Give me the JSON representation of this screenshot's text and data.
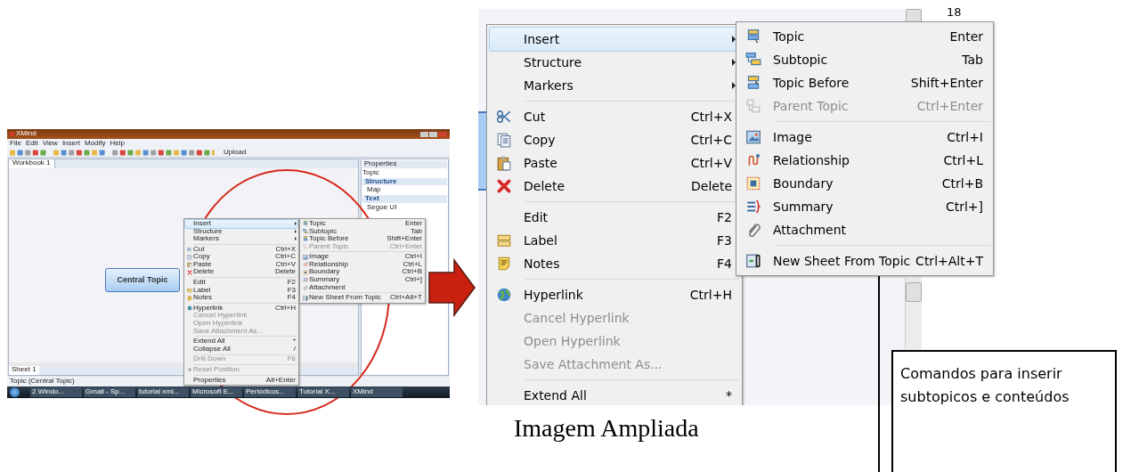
{
  "small_screenshot": {
    "window_title": "XMind",
    "menu": [
      "File",
      "Edit",
      "View",
      "Insert",
      "Modify",
      "Help"
    ],
    "upload": "Upload",
    "tab": "Workbook 1",
    "central_topic": "Central Topic",
    "properties": {
      "title": "Properties",
      "label": "Topic",
      "sections": [
        {
          "title": "Structure",
          "value": "Map"
        },
        {
          "title": "Text",
          "value": "Segoe UI"
        }
      ]
    },
    "sheet_tab": "Sheet 1",
    "status": "Topic (Central Topic)",
    "taskbar": [
      "2 Windo...",
      "Gmail - Sp...",
      "tutorial xml...",
      "Microsoft E...",
      "Periódicos...",
      "Tutorial X...",
      "XMind"
    ],
    "context_menu": [
      {
        "kind": "item",
        "label": "Insert",
        "submenu": true,
        "disabled": false,
        "selected": true
      },
      {
        "kind": "item",
        "label": "Structure",
        "submenu": true,
        "disabled": false,
        "selected": false
      },
      {
        "kind": "item",
        "label": "Markers",
        "submenu": true,
        "disabled": false,
        "selected": false
      },
      {
        "kind": "separator"
      },
      {
        "kind": "item",
        "label": "Cut",
        "shortcut": "Ctrl+X",
        "submenu": false,
        "disabled": false,
        "selected": false
      },
      {
        "kind": "item",
        "label": "Copy",
        "shortcut": "Ctrl+C",
        "submenu": false,
        "disabled": false,
        "selected": false
      },
      {
        "kind": "item",
        "label": "Paste",
        "shortcut": "Ctrl+V",
        "submenu": false,
        "disabled": false,
        "selected": false
      },
      {
        "kind": "item",
        "label": "Delete",
        "shortcut": "Delete",
        "submenu": false,
        "disabled": false,
        "selected": false
      },
      {
        "kind": "separator"
      },
      {
        "kind": "item",
        "label": "Edit",
        "shortcut": "F2",
        "submenu": false,
        "disabled": false,
        "selected": false
      },
      {
        "kind": "item",
        "label": "Label",
        "shortcut": "F3",
        "submenu": false,
        "disabled": false,
        "selected": false
      },
      {
        "kind": "item",
        "label": "Notes",
        "shortcut": "F4",
        "submenu": false,
        "disabled": false,
        "selected": false
      },
      {
        "kind": "separator"
      },
      {
        "kind": "item",
        "label": "Hyperlink",
        "shortcut": "Ctrl+H",
        "submenu": false,
        "disabled": false,
        "selected": false
      },
      {
        "kind": "item",
        "label": "Cancel Hyperlink",
        "submenu": false,
        "disabled": true,
        "selected": false
      },
      {
        "kind": "item",
        "label": "Open Hyperlink",
        "submenu": false,
        "disabled": true,
        "selected": false
      },
      {
        "kind": "item",
        "label": "Save Attachment As...",
        "submenu": false,
        "disabled": true,
        "selected": false
      },
      {
        "kind": "separator"
      },
      {
        "kind": "item",
        "label": "Extend All",
        "shortcut": "*",
        "submenu": false,
        "disabled": false,
        "selected": false
      },
      {
        "kind": "item",
        "label": "Collapse All",
        "shortcut": "/",
        "submenu": false,
        "disabled": false,
        "selected": false
      },
      {
        "kind": "separator"
      },
      {
        "kind": "item",
        "label": "Drill Down",
        "shortcut": "F6",
        "submenu": false,
        "disabled": true,
        "selected": false
      },
      {
        "kind": "separator"
      },
      {
        "kind": "item",
        "label": "Reset Position",
        "submenu": false,
        "disabled": true,
        "selected": false
      },
      {
        "kind": "separator"
      },
      {
        "kind": "item",
        "label": "Properties",
        "shortcut": "Alt+Enter",
        "submenu": false,
        "disabled": false,
        "selected": false
      }
    ],
    "submenu": [
      {
        "kind": "item",
        "label": "Topic",
        "shortcut": "Enter",
        "disabled": false
      },
      {
        "kind": "item",
        "label": "Subtopic",
        "shortcut": "Tab",
        "disabled": false
      },
      {
        "kind": "item",
        "label": "Topic Before",
        "shortcut": "Shift+Enter",
        "disabled": false
      },
      {
        "kind": "item",
        "label": "Parent Topic",
        "shortcut": "Ctrl+Enter",
        "disabled": true
      },
      {
        "kind": "separator"
      },
      {
        "kind": "item",
        "label": "Image",
        "shortcut": "Ctrl+I",
        "disabled": false
      },
      {
        "kind": "item",
        "label": "Relationship",
        "shortcut": "Ctrl+L",
        "disabled": false
      },
      {
        "kind": "item",
        "label": "Boundary",
        "shortcut": "Ctrl+B",
        "disabled": false
      },
      {
        "kind": "item",
        "label": "Summary",
        "shortcut": "Ctrl+]",
        "disabled": false
      },
      {
        "kind": "item",
        "label": "Attachment",
        "disabled": false
      },
      {
        "kind": "separator"
      },
      {
        "kind": "item",
        "label": "New Sheet From Topic",
        "shortcut": "Ctrl+Alt+T",
        "disabled": false
      }
    ]
  },
  "enlarged": {
    "page_number": "18",
    "context_menu": [
      {
        "kind": "item",
        "label": "Insert",
        "submenu": true,
        "disabled": false,
        "selected": true
      },
      {
        "kind": "item",
        "label": "Structure",
        "submenu": true,
        "disabled": false,
        "selected": false
      },
      {
        "kind": "item",
        "label": "Markers",
        "submenu": true,
        "disabled": false,
        "selected": false
      },
      {
        "kind": "separator"
      },
      {
        "kind": "item",
        "label": "Cut",
        "shortcut": "Ctrl+X",
        "submenu": false,
        "disabled": false,
        "selected": false
      },
      {
        "kind": "item",
        "label": "Copy",
        "shortcut": "Ctrl+C",
        "submenu": false,
        "disabled": false,
        "selected": false
      },
      {
        "kind": "item",
        "label": "Paste",
        "shortcut": "Ctrl+V",
        "submenu": false,
        "disabled": false,
        "selected": false
      },
      {
        "kind": "item",
        "label": "Delete",
        "shortcut": "Delete",
        "submenu": false,
        "disabled": false,
        "selected": false
      },
      {
        "kind": "separator"
      },
      {
        "kind": "item",
        "label": "Edit",
        "shortcut": "F2",
        "submenu": false,
        "disabled": false,
        "selected": false
      },
      {
        "kind": "item",
        "label": "Label",
        "shortcut": "F3",
        "submenu": false,
        "disabled": false,
        "selected": false
      },
      {
        "kind": "item",
        "label": "Notes",
        "shortcut": "F4",
        "submenu": false,
        "disabled": false,
        "selected": false
      },
      {
        "kind": "separator"
      },
      {
        "kind": "item",
        "label": "Hyperlink",
        "shortcut": "Ctrl+H",
        "submenu": false,
        "disabled": false,
        "selected": false
      },
      {
        "kind": "item",
        "label": "Cancel Hyperlink",
        "submenu": false,
        "disabled": true,
        "selected": false
      },
      {
        "kind": "item",
        "label": "Open Hyperlink",
        "submenu": false,
        "disabled": true,
        "selected": false
      },
      {
        "kind": "item",
        "label": "Save Attachment As...",
        "submenu": false,
        "disabled": true,
        "selected": false
      },
      {
        "kind": "separator"
      },
      {
        "kind": "item",
        "label": "Extend All",
        "shortcut": "*",
        "submenu": false,
        "disabled": false,
        "selected": false
      }
    ],
    "submenu": [
      {
        "kind": "item",
        "label": "Topic",
        "shortcut": "Enter",
        "disabled": false
      },
      {
        "kind": "item",
        "label": "Subtopic",
        "shortcut": "Tab",
        "disabled": false
      },
      {
        "kind": "item",
        "label": "Topic Before",
        "shortcut": "Shift+Enter",
        "disabled": false
      },
      {
        "kind": "item",
        "label": "Parent Topic",
        "shortcut": "Ctrl+Enter",
        "disabled": true
      },
      {
        "kind": "separator"
      },
      {
        "kind": "item",
        "label": "Image",
        "shortcut": "Ctrl+I",
        "disabled": false
      },
      {
        "kind": "item",
        "label": "Relationship",
        "shortcut": "Ctrl+L",
        "disabled": false
      },
      {
        "kind": "item",
        "label": "Boundary",
        "shortcut": "Ctrl+B",
        "disabled": false
      },
      {
        "kind": "item",
        "label": "Summary",
        "shortcut": "Ctrl+]",
        "disabled": false
      },
      {
        "kind": "item",
        "label": "Attachment",
        "disabled": false
      },
      {
        "kind": "separator"
      },
      {
        "kind": "item",
        "label": "New Sheet From Topic",
        "shortcut": "Ctrl+Alt+T",
        "disabled": false
      }
    ]
  },
  "callout": "Comandos para inserir subtopicos e conteúdos",
  "caption": "Imagem Ampliada"
}
